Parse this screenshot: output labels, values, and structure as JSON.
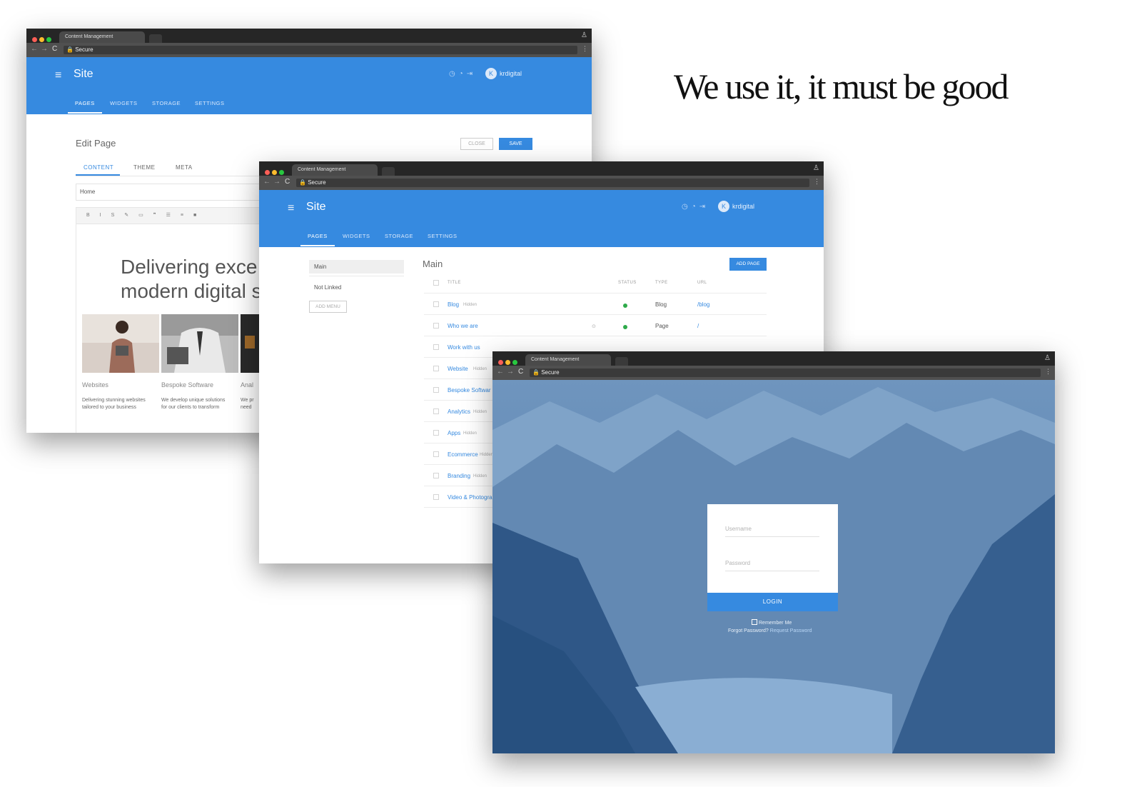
{
  "tagline": "We use it, it must be good",
  "browser": {
    "tab_title": "Content Management",
    "address": "Secure",
    "back_glyph": "←",
    "forward_glyph": "→",
    "reload_glyph": "C",
    "menu_glyph": "⋮"
  },
  "app": {
    "site_title": "Site",
    "user_initial": "K",
    "user_name": "krdigital",
    "nav_tabs": [
      "PAGES",
      "WIDGETS",
      "STORAGE",
      "SETTINGS"
    ],
    "active_tab": "PAGES",
    "accent_color": "#368ae0"
  },
  "edit_page": {
    "title": "Edit Page",
    "close_label": "CLOSE",
    "save_label": "SAVE",
    "tabs": [
      "CONTENT",
      "THEME",
      "META"
    ],
    "page_name": "Home",
    "toolbar": [
      "B",
      "I",
      "S",
      "✎",
      "▭",
      "❞",
      "☰",
      "≡",
      "■"
    ],
    "hero_line1": "Delivering exce",
    "hero_line2": "modern digital s",
    "cards": [
      {
        "title": "Websites",
        "desc1": "Delivering stunning websites",
        "desc2": "tailored to your business"
      },
      {
        "title": "Bespoke Software",
        "desc1": "We develop unique solutions",
        "desc2": "for our clients to transform"
      },
      {
        "title": "Anal",
        "desc1": "We pr",
        "desc2": "need"
      }
    ]
  },
  "pages_list": {
    "menus": [
      "Main",
      "Not Linked"
    ],
    "add_menu_label": "ADD MENU",
    "heading": "Main",
    "add_page_label": "ADD PAGE",
    "columns": [
      "TITLE",
      "STATUS",
      "TYPE",
      "URL"
    ],
    "hidden_label": "Hidden",
    "rows": [
      {
        "title": "Blog",
        "hidden": true,
        "status": "live",
        "type": "Blog",
        "url": "/blog"
      },
      {
        "title": "Who we are",
        "hidden": false,
        "status": "live",
        "type": "Page",
        "url": "/"
      },
      {
        "title": "Work with us",
        "hidden": false
      },
      {
        "title": "Website",
        "hidden": true
      },
      {
        "title": "Bespoke Softwar",
        "hidden": false
      },
      {
        "title": "Analytics",
        "hidden": true
      },
      {
        "title": "Apps",
        "hidden": true
      },
      {
        "title": "Ecommerce",
        "hidden": true
      },
      {
        "title": "Branding",
        "hidden": true
      },
      {
        "title": "Video & Photogra",
        "hidden": false
      }
    ]
  },
  "login": {
    "username_placeholder": "Username",
    "password_placeholder": "Password",
    "login_label": "LOGIN",
    "remember_label": "Remember Me",
    "forgot_text": "Forgot Password?",
    "request_link": "Request Password"
  }
}
